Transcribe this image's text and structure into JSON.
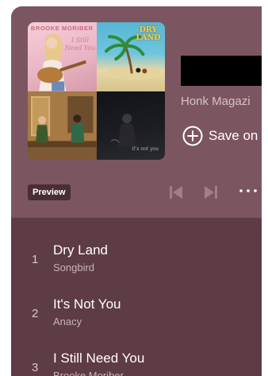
{
  "playlist": {
    "publisher": "Honk Magazi",
    "save_label": "Save on",
    "preview_label": "Preview"
  },
  "cover": {
    "tile1_artist": "BROOKE MORIBER",
    "tile1_script": "I Still Need You",
    "tile2_logo": "DRY LAND",
    "tile4_script": "it's not you"
  },
  "tracks": [
    {
      "number": "1",
      "title": "Dry Land",
      "artist": "Songbird"
    },
    {
      "number": "2",
      "title": "It's Not You",
      "artist": "Anacy"
    },
    {
      "number": "3",
      "title": "I Still Need You",
      "artist": "Brooke Moriber"
    }
  ],
  "icons": {
    "save": "plus-circle-icon",
    "prev": "skip-previous-icon",
    "next": "skip-next-icon",
    "more": "more-horizontal-icon"
  },
  "colors": {
    "header_bg": "#7b5660",
    "list_bg": "#5e3c45",
    "badge_bg": "#4a2e35"
  }
}
